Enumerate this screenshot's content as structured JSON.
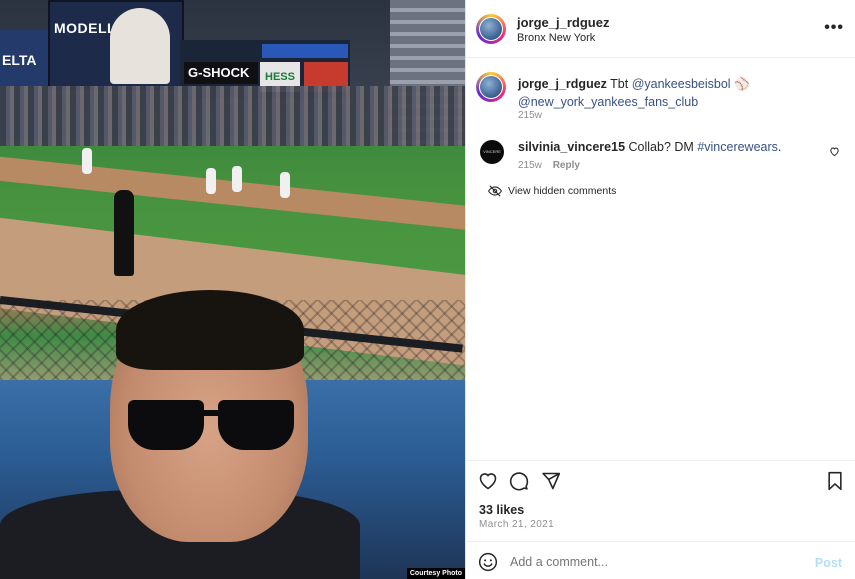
{
  "photo": {
    "scoreboard_brand": "MODELL'S",
    "ad_brand": "G-SHOCK",
    "ad_brand2": "HESS",
    "wall_text": "ELTA",
    "credit": "Courtesy Photo"
  },
  "post": {
    "username": "jorge_j_rdguez",
    "location": "Bronx New York",
    "more_icon": "more-horizontal-icon",
    "caption": {
      "username": "jorge_j_rdguez",
      "text": "Tbt",
      "mention1": "@yankeesbeisbol",
      "emoji": "⚾",
      "mention2": "@new_york_yankees_fans_club",
      "time": "215w"
    },
    "comment": {
      "avatar_text": "VINCERE",
      "username": "silvinia_vincere15",
      "text": "Collab? DM",
      "hashtag": "#vincerewears",
      "suffix": ".",
      "time": "215w",
      "reply": "Reply"
    },
    "hidden_comments": "View hidden comments",
    "likes": "33 likes",
    "date": "March 21, 2021",
    "add_comment_placeholder": "Add a comment...",
    "post_label": "Post"
  },
  "colors": {
    "mention": "#385185",
    "muted": "#8e8e8e",
    "post_disabled": "#b2dffc"
  }
}
